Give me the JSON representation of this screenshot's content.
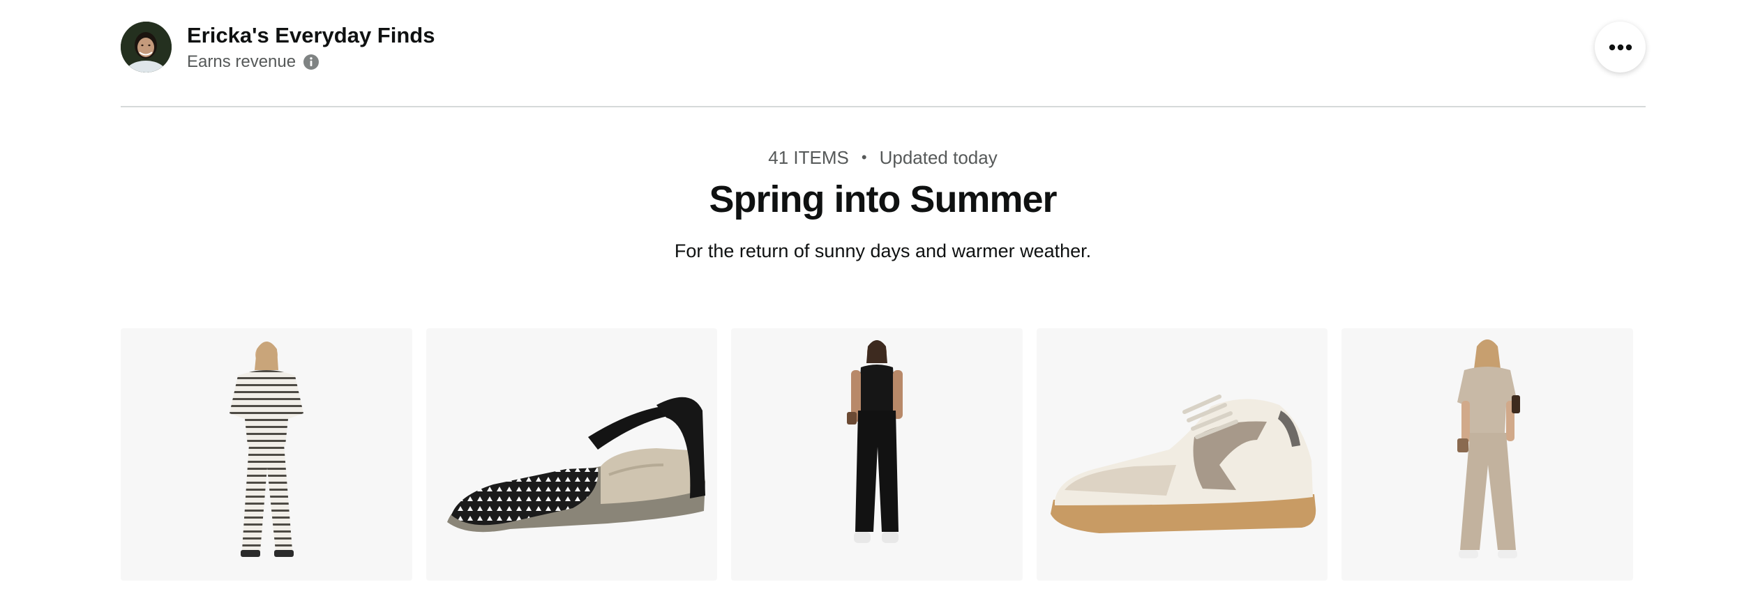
{
  "header": {
    "store_name": "Ericka's Everyday Finds",
    "revenue_label": "Earns revenue",
    "avatar_icon": "avatar",
    "info_icon": "info-icon",
    "more_icon": "more-options-icon"
  },
  "list": {
    "item_count": "41 ITEMS",
    "separator": "•",
    "updated": "Updated today",
    "title": "Spring into Summer",
    "description": "For the return of sunny days and warmer weather."
  },
  "products": [
    {
      "name": "striped-lounge-set-image",
      "color": "#ece9e2"
    },
    {
      "name": "black-cutout-flat-sandal-image",
      "color": "#1a1a1a"
    },
    {
      "name": "black-jumpsuit-image",
      "color": "#151515"
    },
    {
      "name": "white-retro-sneaker-image",
      "color": "#efeae0"
    },
    {
      "name": "taupe-two-piece-set-image",
      "color": "#c8b9a6"
    }
  ],
  "colors": {
    "text_primary": "#0f1111",
    "text_secondary": "#565959",
    "divider": "#d5d9d9",
    "card_background": "#f7f7f7"
  }
}
